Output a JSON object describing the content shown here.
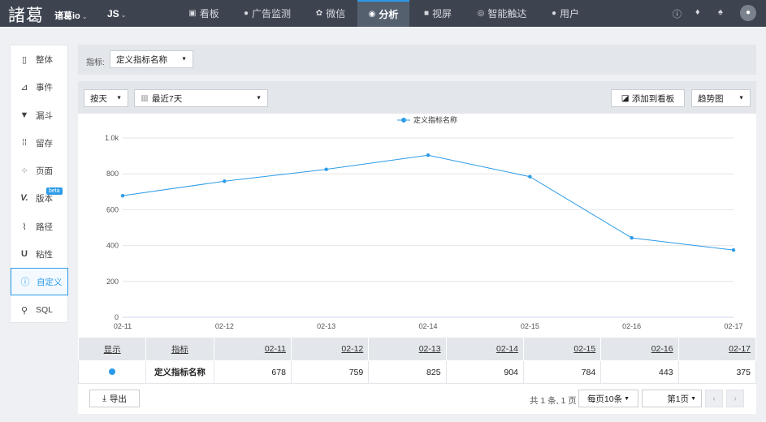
{
  "header": {
    "logo": "諸葛",
    "project": "诸葛io",
    "platform": "JS",
    "nav": [
      {
        "label": "看板",
        "icon": "board-icon"
      },
      {
        "label": "广告监测",
        "icon": "ad-monitor-icon"
      },
      {
        "label": "微信",
        "icon": "wechat-icon"
      },
      {
        "label": "分析",
        "icon": "analysis-icon",
        "active": true
      },
      {
        "label": "视屏",
        "icon": "video-icon"
      },
      {
        "label": "智能触达",
        "icon": "smart-reach-icon"
      },
      {
        "label": "用户",
        "icon": "user-icon"
      }
    ]
  },
  "sidebar": {
    "items": [
      {
        "label": "整体",
        "icon": "overall-icon"
      },
      {
        "label": "事件",
        "icon": "event-icon"
      },
      {
        "label": "漏斗",
        "icon": "funnel-icon"
      },
      {
        "label": "留存",
        "icon": "retention-icon"
      },
      {
        "label": "页面",
        "icon": "page-icon"
      },
      {
        "label": "版本",
        "icon": "version-icon",
        "badge": "beta"
      },
      {
        "label": "路径",
        "icon": "path-icon"
      },
      {
        "label": "粘性",
        "icon": "stickiness-icon"
      },
      {
        "label": "自定义",
        "icon": "custom-icon",
        "active": true
      },
      {
        "label": "SQL",
        "icon": "sql-icon"
      }
    ]
  },
  "metric_bar": {
    "label": "指标:",
    "selected": "定义指标名称"
  },
  "controls": {
    "granularity": "按天",
    "date_range": "最近7天",
    "add_to_board": "添加到看板",
    "chart_type": "趋势图"
  },
  "chart_data": {
    "type": "line",
    "x": [
      "02-11",
      "02-12",
      "02-13",
      "02-14",
      "02-15",
      "02-16",
      "02-17"
    ],
    "series": [
      {
        "name": "定义指标名称",
        "values": [
          678,
          759,
          825,
          904,
          784,
          443,
          375
        ],
        "color": "#2b9be8"
      }
    ],
    "y_ticks": [
      "0",
      "200",
      "400",
      "600",
      "800",
      "1.0k"
    ],
    "ylim": [
      0,
      1000
    ],
    "grid": true,
    "legend": "top-center"
  },
  "table": {
    "headers": [
      "显示",
      "指标",
      "02-11",
      "02-12",
      "02-13",
      "02-14",
      "02-15",
      "02-16",
      "02-17"
    ],
    "rows": [
      {
        "name": "定义指标名称",
        "values": [
          "678",
          "759",
          "825",
          "904",
          "784",
          "443",
          "375"
        ]
      }
    ]
  },
  "footer": {
    "export": "导出",
    "summary": "共 1 条, 1 页",
    "page_size": "每页10条",
    "page": "第1页"
  },
  "colors": {
    "accent": "#2b9be8",
    "topbar": "#3d4450"
  }
}
